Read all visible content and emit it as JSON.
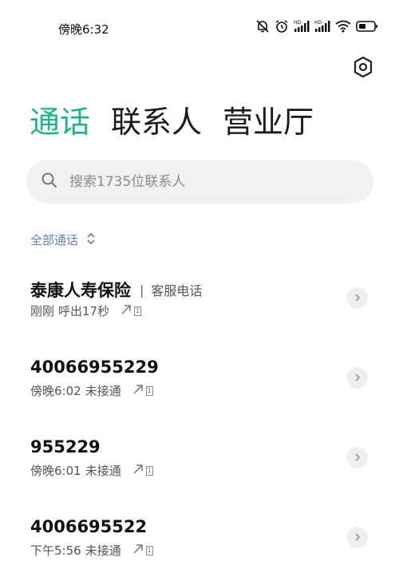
{
  "status_bar": {
    "time": "傍晚6:32"
  },
  "tabs": [
    {
      "label": "通话",
      "active": true
    },
    {
      "label": "联系人",
      "active": false
    },
    {
      "label": "营业厅",
      "active": false
    }
  ],
  "search": {
    "placeholder": "搜索1735位联系人"
  },
  "filter": {
    "label": "全部通话"
  },
  "calls": [
    {
      "name": "泰康人寿保险",
      "tag": "客服电话",
      "time": "刚刚",
      "status": "呼出17秒",
      "sim": "1"
    },
    {
      "name": "40066955229",
      "tag": "",
      "time": "傍晚6:02",
      "status": "未接通",
      "sim": "1"
    },
    {
      "name": "955229",
      "tag": "",
      "time": "傍晚6:01",
      "status": "未接通",
      "sim": "1"
    },
    {
      "name": "4006695522",
      "tag": "",
      "time": "下午5:56",
      "status": "未接通",
      "sim": "1"
    }
  ],
  "colors": {
    "accent": "#1fb483",
    "filter_text": "#6b7fa8"
  }
}
